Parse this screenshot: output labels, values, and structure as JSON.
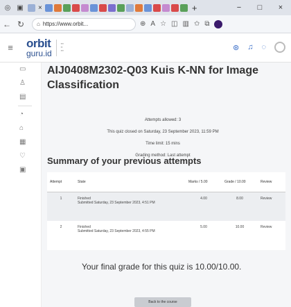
{
  "browser": {
    "tab_close_glyph": "×",
    "new_tab_glyph": "+",
    "window_controls": [
      "−",
      "□",
      "×"
    ],
    "url": "https://www.orbit..."
  },
  "site": {
    "logo_main": "orbit",
    "logo_sub": "guru.id"
  },
  "quiz": {
    "title": "AIJ0408M2302-Q03 Kuis K-NN for Image Classification",
    "attempts_allowed": "Attempts allowed: 3",
    "closed_on": "This quiz closed on Saturday, 23 September 2023, 11:59 PM",
    "time_limit": "Time limit: 15 mins",
    "grading_method": "Grading method: Last attempt"
  },
  "summary": {
    "title": "Summary of your previous attempts",
    "headers": {
      "attempt": "Attempt",
      "state": "State",
      "marks": "Marks / 5.00",
      "grade": "Grade / 10.00",
      "review": "Review"
    },
    "rows": [
      {
        "attempt": "1",
        "state": "Finished",
        "submitted": "Submitted Saturday, 23 September 2023, 4:51 PM",
        "marks": "4.00",
        "grade": "8.00",
        "review": "Review"
      },
      {
        "attempt": "2",
        "state": "Finished",
        "submitted": "Submitted Saturday, 23 September 2023, 4:55 PM",
        "marks": "5.00",
        "grade": "10.00",
        "review": "Review"
      }
    ]
  },
  "final_grade": "Your final grade for this quiz is 10.00/10.00.",
  "back_button": "Back to the course",
  "colors": {
    "brand": "#2a4f8f",
    "link": "#3b6fc9",
    "content_bg": "#f5f6f8"
  }
}
